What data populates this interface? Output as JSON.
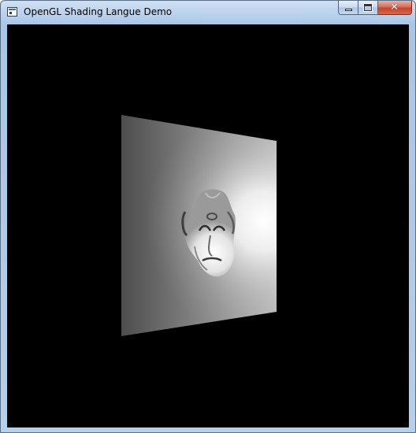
{
  "window": {
    "title": "OpenGL Shading Langue Demo",
    "icon": "app-window-icon",
    "buttons": {
      "minimize_icon": "minimize-icon",
      "maximize_icon": "maximize-icon",
      "close_icon": "close-icon",
      "close_glyph": "✕"
    }
  },
  "colors": {
    "client_background": "#000000",
    "plane_dark": "#4a4a4a",
    "plane_light": "#ffffff",
    "close_button": "#c4432c"
  },
  "viewport": {
    "scene": "perspective-quad-with-relief-face-texture"
  }
}
